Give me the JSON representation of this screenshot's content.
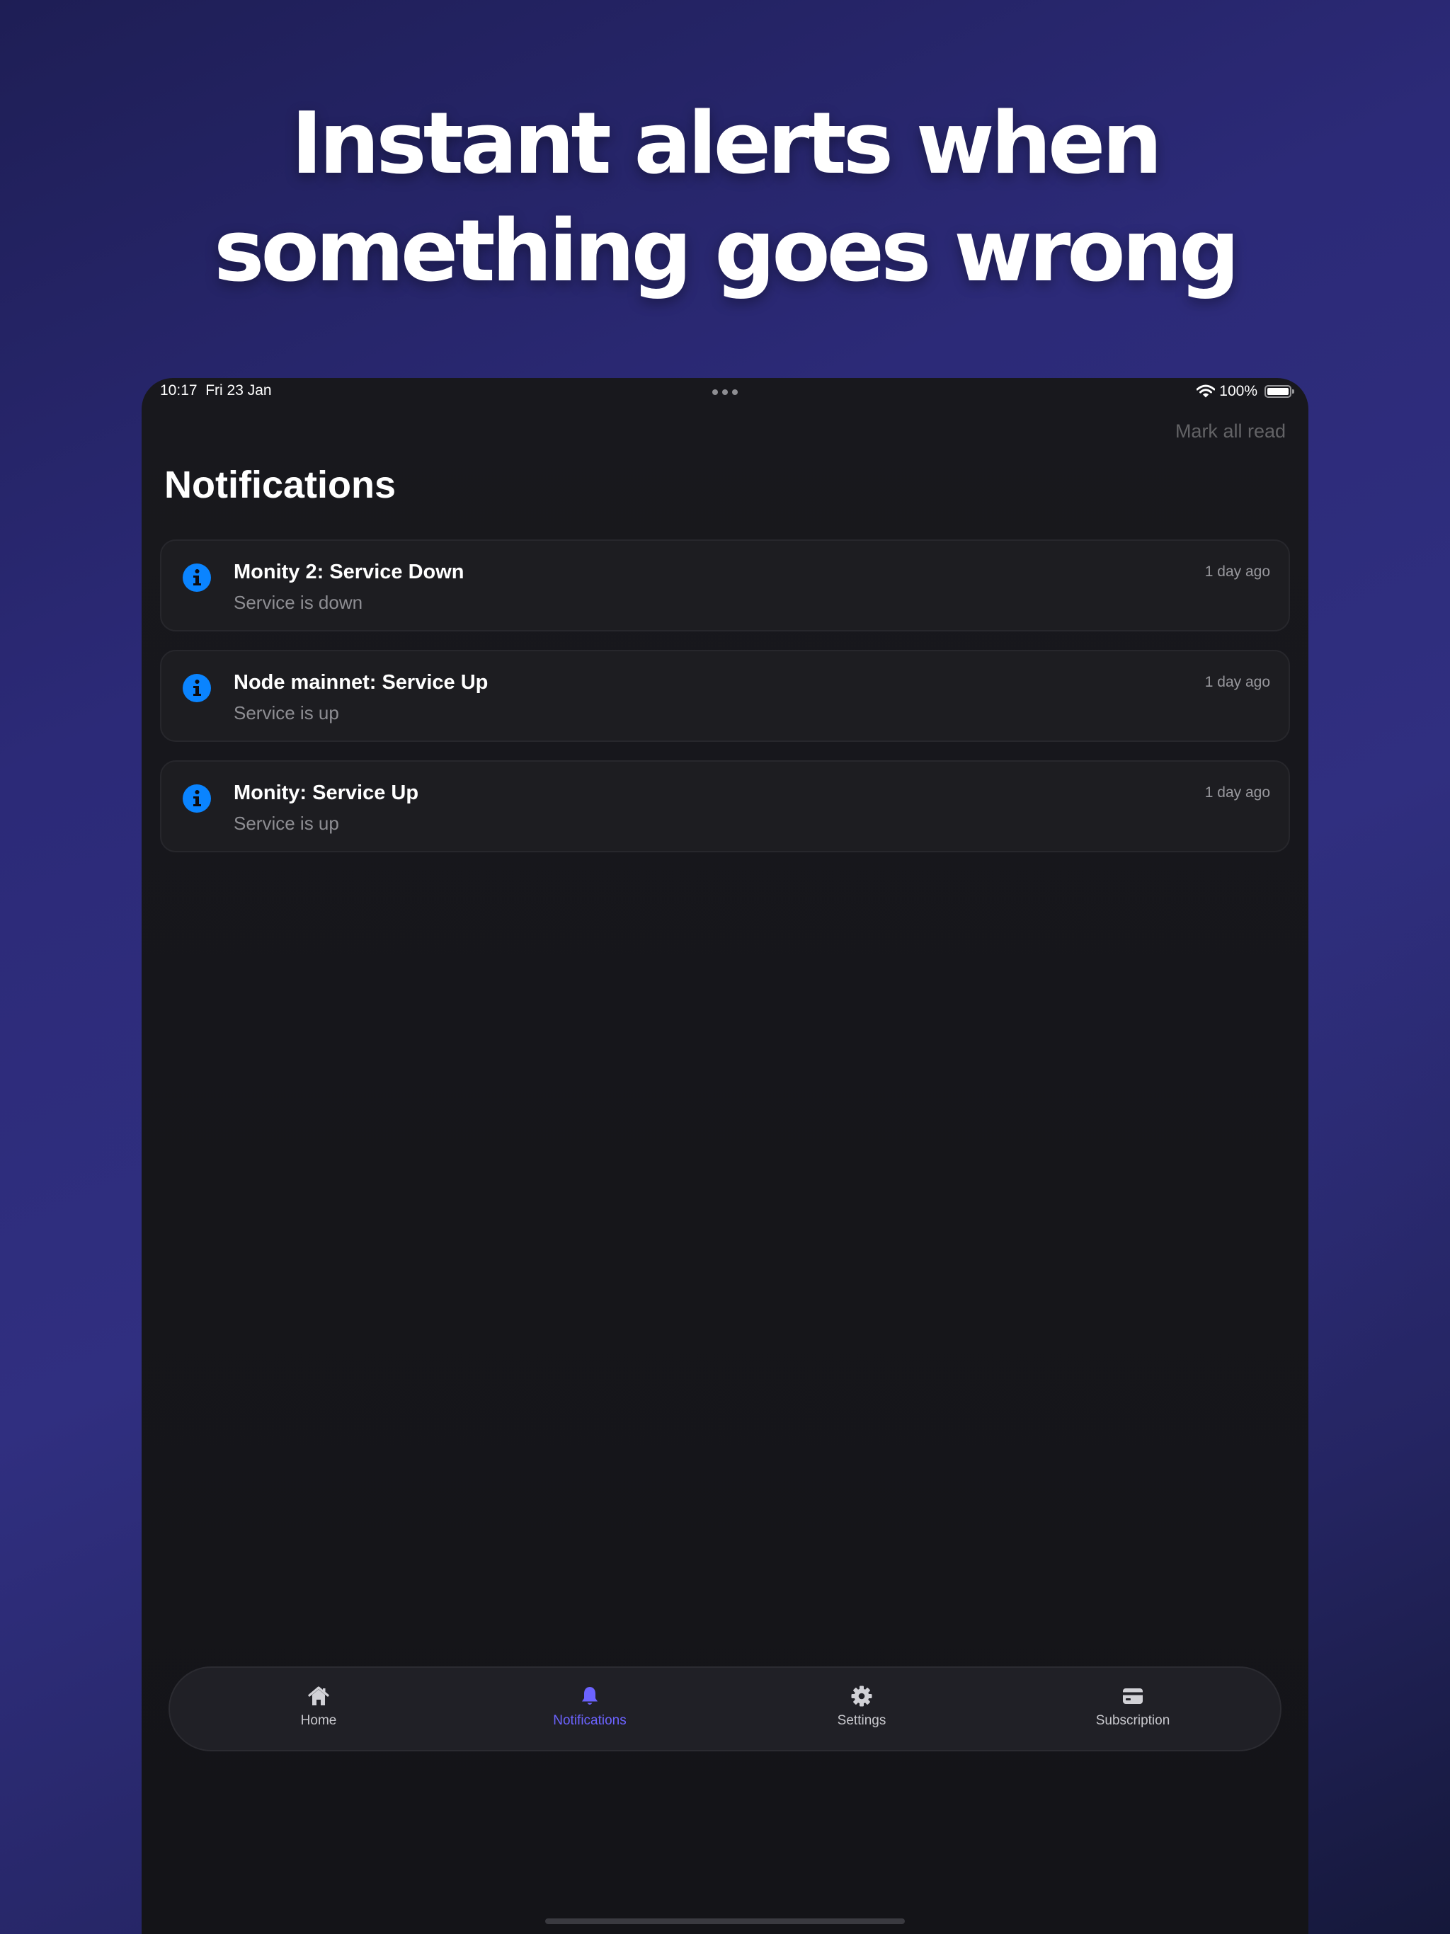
{
  "headline": {
    "line1": "Instant alerts when",
    "line2": "something goes wrong"
  },
  "status_bar": {
    "time": "10:17",
    "date": "Fri 23 Jan",
    "battery": "100%"
  },
  "header": {
    "mark_all_read": "Mark all read",
    "title": "Notifications"
  },
  "notifications": [
    {
      "title": "Monity 2: Service Down",
      "body": "Service is down",
      "time": "1 day ago",
      "icon": "info-icon"
    },
    {
      "title": "Node mainnet: Service Up",
      "body": "Service is up",
      "time": "1 day ago",
      "icon": "info-icon"
    },
    {
      "title": "Monity: Service Up",
      "body": "Service is up",
      "time": "1 day ago",
      "icon": "info-icon"
    }
  ],
  "tabs": [
    {
      "label": "Home",
      "icon": "home-icon",
      "active": false
    },
    {
      "label": "Notifications",
      "icon": "bell-icon",
      "active": true
    },
    {
      "label": "Settings",
      "icon": "gear-icon",
      "active": false
    },
    {
      "label": "Subscription",
      "icon": "credit-card-icon",
      "active": false
    }
  ],
  "colors": {
    "accent": "#6c63ff",
    "info_blue": "#0a84ff",
    "background_top": "#1e1e55",
    "background_mid": "#302f80",
    "app_background": "#161619",
    "card_background": "#1d1d21"
  }
}
